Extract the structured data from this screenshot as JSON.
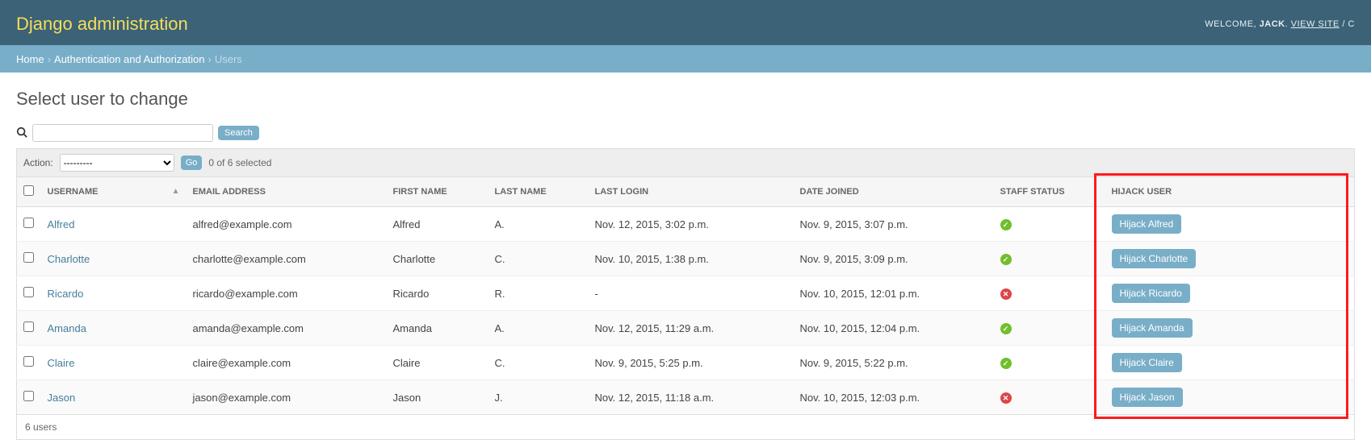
{
  "header": {
    "site_title": "Django administration",
    "welcome_prefix": "WELCOME, ",
    "username": "JACK",
    "view_site": "VIEW SITE",
    "sep": " / ",
    "trailing": "C"
  },
  "breadcrumbs": {
    "home": "Home",
    "app": "Authentication and Authorization",
    "current": "Users"
  },
  "page": {
    "title": "Select user to change"
  },
  "search": {
    "value": "",
    "button": "Search"
  },
  "actions": {
    "label": "Action:",
    "placeholder": "---------",
    "go": "Go",
    "selection": "0 of 6 selected"
  },
  "columns": {
    "username": "USERNAME",
    "email": "EMAIL ADDRESS",
    "first": "FIRST NAME",
    "last": "LAST NAME",
    "login": "LAST LOGIN",
    "joined": "DATE JOINED",
    "staff": "STAFF STATUS",
    "hijack": "HIJACK USER"
  },
  "rows": [
    {
      "username": "Alfred",
      "email": "alfred@example.com",
      "first": "Alfred",
      "last": "A.",
      "login": "Nov. 12, 2015, 3:02 p.m.",
      "joined": "Nov. 9, 2015, 3:07 p.m.",
      "staff": true,
      "hijack": "Hijack Alfred"
    },
    {
      "username": "Charlotte",
      "email": "charlotte@example.com",
      "first": "Charlotte",
      "last": "C.",
      "login": "Nov. 10, 2015, 1:38 p.m.",
      "joined": "Nov. 9, 2015, 3:09 p.m.",
      "staff": true,
      "hijack": "Hijack Charlotte"
    },
    {
      "username": "Ricardo",
      "email": "ricardo@example.com",
      "first": "Ricardo",
      "last": "R.",
      "login": "-",
      "joined": "Nov. 10, 2015, 12:01 p.m.",
      "staff": false,
      "hijack": "Hijack Ricardo"
    },
    {
      "username": "Amanda",
      "email": "amanda@example.com",
      "first": "Amanda",
      "last": "A.",
      "login": "Nov. 12, 2015, 11:29 a.m.",
      "joined": "Nov. 10, 2015, 12:04 p.m.",
      "staff": true,
      "hijack": "Hijack Amanda"
    },
    {
      "username": "Claire",
      "email": "claire@example.com",
      "first": "Claire",
      "last": "C.",
      "login": "Nov. 9, 2015, 5:25 p.m.",
      "joined": "Nov. 9, 2015, 5:22 p.m.",
      "staff": true,
      "hijack": "Hijack Claire"
    },
    {
      "username": "Jason",
      "email": "jason@example.com",
      "first": "Jason",
      "last": "J.",
      "login": "Nov. 12, 2015, 11:18 a.m.",
      "joined": "Nov. 10, 2015, 12:03 p.m.",
      "staff": false,
      "hijack": "Hijack Jason"
    }
  ],
  "paginator": {
    "summary": "6 users"
  }
}
